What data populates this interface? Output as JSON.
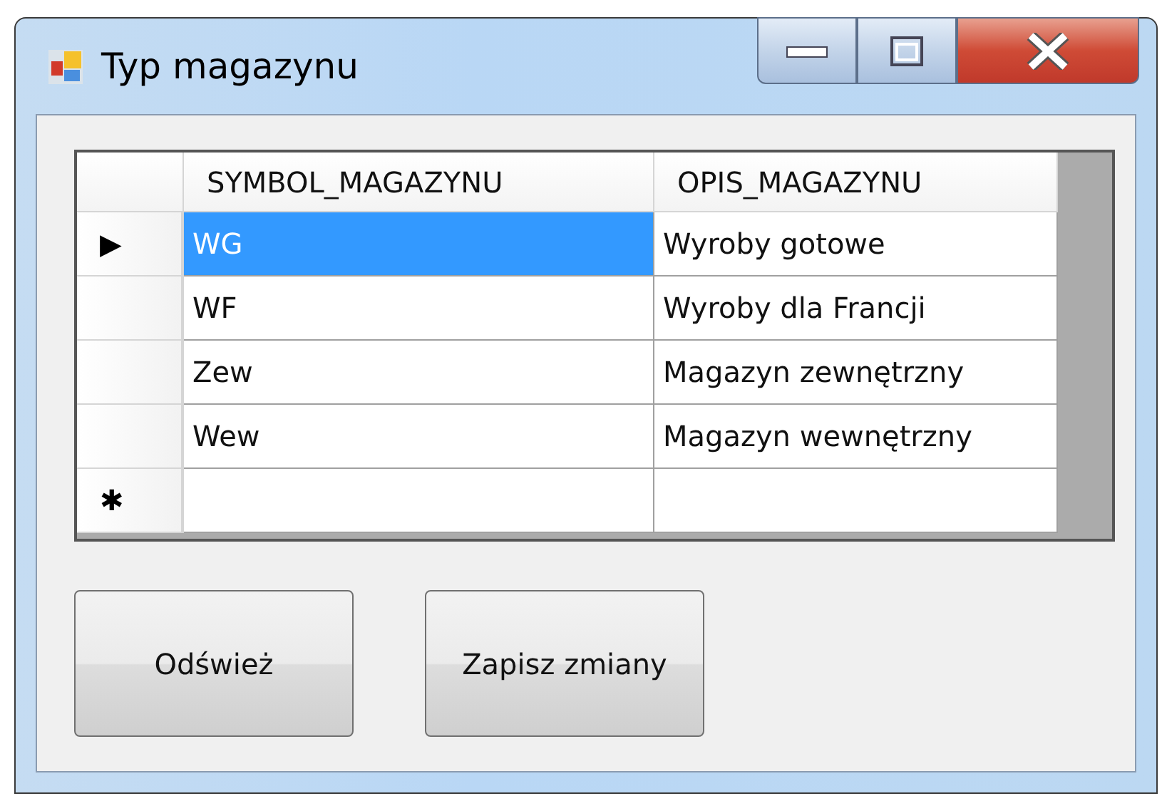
{
  "window": {
    "title": "Typ magazynu"
  },
  "grid": {
    "columns": [
      "SYMBOL_MAGAZYNU",
      "OPIS_MAGAZYNU"
    ],
    "rows": [
      {
        "marker": "▶",
        "cells": [
          {
            "text": "WG",
            "selected": true
          },
          {
            "text": "Wyroby gotowe",
            "selected": false
          }
        ]
      },
      {
        "cells": [
          {
            "text": "WF",
            "selected": false
          },
          {
            "text": "Wyroby dla Francji",
            "selected": false
          }
        ]
      },
      {
        "cells": [
          {
            "text": "Zew",
            "selected": false
          },
          {
            "text": "Magazyn zewnętrzny",
            "selected": false
          }
        ]
      },
      {
        "cells": [
          {
            "text": "Wew",
            "selected": false
          },
          {
            "text": "Magazyn wewnętrzny",
            "selected": false
          }
        ]
      },
      {
        "marker": "✱",
        "kind": "new"
      }
    ]
  },
  "buttons": [
    "Odśwież",
    "Zapisz zmiany"
  ]
}
